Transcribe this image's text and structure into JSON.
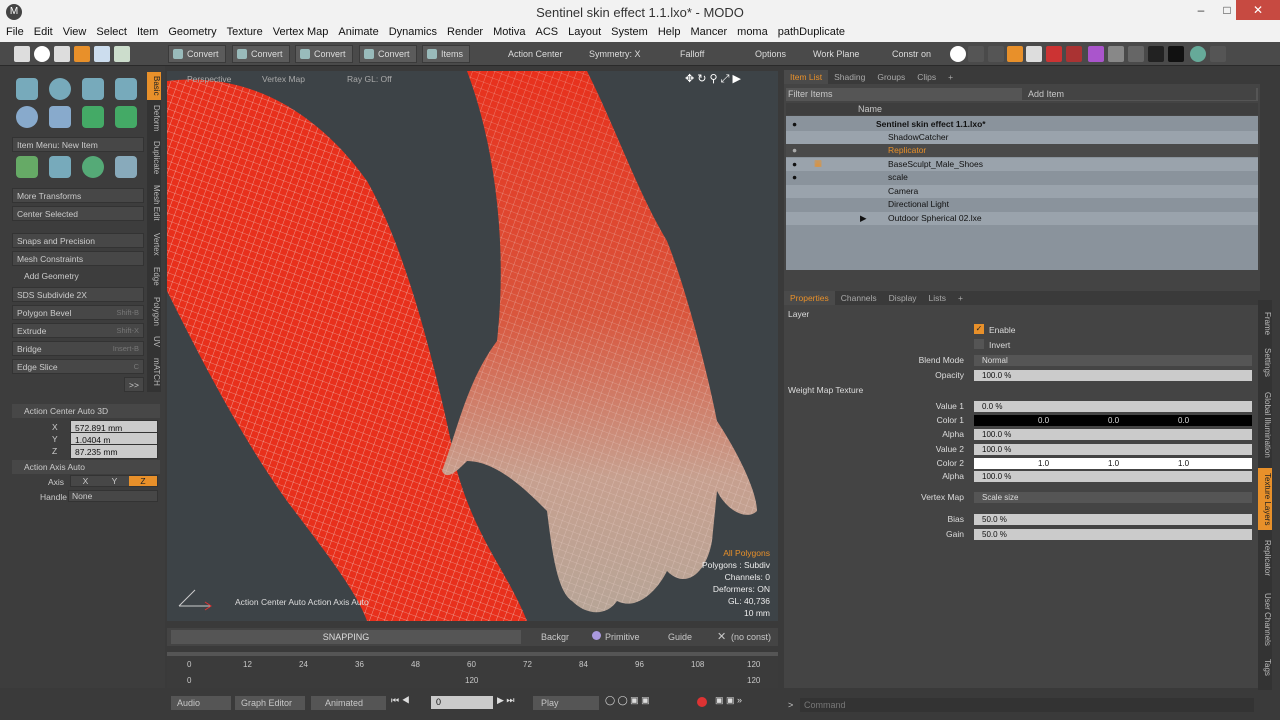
{
  "window": {
    "title": "Sentinel skin effect 1.1.lxo* - MODO",
    "app_icon": "modo-logo"
  },
  "menu": [
    "File",
    "Edit",
    "View",
    "Select",
    "Item",
    "Geometry",
    "Texture",
    "Vertex Map",
    "Animate",
    "Dynamics",
    "Render",
    "Motiva",
    "ACS",
    "Layout",
    "System",
    "Help",
    "Mancer",
    "moma",
    "pathDuplicate"
  ],
  "toolbar": {
    "convert1": "Convert",
    "convert2": "Convert",
    "convert3": "Convert",
    "convert4": "Convert",
    "items": "Items",
    "action_center": "Action Center",
    "symmetry": "Symmetry: X",
    "falloff": "Falloff",
    "options": "Options",
    "work_plane": "Work Plane",
    "constrain": "Constr on"
  },
  "left": {
    "vtabs": [
      "Basic",
      "Deform",
      "Duplicate",
      "Mesh Edit",
      "Vertex",
      "Edge",
      "Polygon",
      "UV",
      "mATCH"
    ],
    "item_menu": "Item Menu: New Item",
    "more_transforms": "More Transforms",
    "center_selected": "Center Selected",
    "snaps": "Snaps and Precision",
    "mesh_constraints": "Mesh Constraints",
    "add_geometry": "Add Geometry",
    "tools": [
      {
        "label": "SDS Subdivide 2X",
        "key": ""
      },
      {
        "label": "Polygon Bevel",
        "key": "Shift-B"
      },
      {
        "label": "Extrude",
        "key": "Shift-X"
      },
      {
        "label": "Bridge",
        "key": "Insert-B"
      },
      {
        "label": "Edge Slice",
        "key": "C"
      }
    ],
    "more": ">>",
    "action_center": "Action Center Auto 3D",
    "x": "572.891 mm",
    "y": "1.0404 m",
    "z": "87.235 mm",
    "x_label": "X",
    "y_label": "Y",
    "z_label": "Z",
    "action_axis": "Action Axis Auto",
    "axis_label": "Axis",
    "handle_label": "Handle",
    "handle_value": "None"
  },
  "viewport": {
    "view": "Perspective",
    "mode": "Vertex Map",
    "raygl": "Ray GL: Off",
    "info": {
      "polys": "All Polygons",
      "subdiv": "Polygons : Subdiv",
      "channels": "Channels: 0",
      "deformers": "Deformers: ON",
      "gl": "GL: 40,736",
      "scale": "10 mm"
    },
    "bottom_left": "Action Center Auto    Action Axis Auto"
  },
  "status": {
    "snapping": "SNAPPING",
    "backgr": "Backgr",
    "primitive": "Primitive",
    "guide": "Guide",
    "noconst": "(no const)"
  },
  "timeline": {
    "ticks": [
      "0",
      "12",
      "24",
      "36",
      "48",
      "60",
      "72",
      "84",
      "96",
      "108",
      "120"
    ],
    "start": "0",
    "end": "120",
    "current": "120"
  },
  "bottom": {
    "audio": "Audio",
    "graph": "Graph Editor",
    "animated": "Animated",
    "frame": "0",
    "play": "Play"
  },
  "itemlist": {
    "tabs": [
      "Item List",
      "Shading",
      "Groups",
      "Clips"
    ],
    "filter": "Filter Items",
    "add_item": "Add Item",
    "col_name": "Name",
    "items": [
      {
        "name": "Sentinel skin effect 1.1.lxo*",
        "level": 0
      },
      {
        "name": "ShadowCatcher",
        "level": 1
      },
      {
        "name": "Replicator",
        "level": 1
      },
      {
        "name": "BaseSculpt_Male_Shoes",
        "level": 1
      },
      {
        "name": "scale",
        "level": 1
      },
      {
        "name": "Camera",
        "level": 1
      },
      {
        "name": "Directional Light",
        "level": 1
      },
      {
        "name": "Outdoor Spherical 02.lxe",
        "level": 1
      }
    ]
  },
  "props": {
    "tabs": [
      "Properties",
      "Channels",
      "Display",
      "Lists"
    ],
    "layer": "Layer",
    "enable": "Enable",
    "invert": "Invert",
    "blend_mode_label": "Blend Mode",
    "blend_mode": "Normal",
    "opacity_label": "Opacity",
    "opacity": "100.0 %",
    "wmt": "Weight Map Texture",
    "value1_label": "Value 1",
    "value1": "0.0 %",
    "color1_label": "Color 1",
    "color1": [
      "0.0",
      "0.0",
      "0.0"
    ],
    "alpha1_label": "Alpha",
    "alpha1": "100.0 %",
    "value2_label": "Value 2",
    "value2": "100.0 %",
    "color2_label": "Color 2",
    "color2": [
      "1.0",
      "1.0",
      "1.0"
    ],
    "alpha2_label": "Alpha",
    "alpha2": "100.0 %",
    "vmap_label": "Vertex Map",
    "vmap": "Scale size",
    "bias_label": "Bias",
    "bias": "50.0 %",
    "gain_label": "Gain",
    "gain": "50.0 %",
    "vtabs": [
      "Frame",
      "Settings",
      "Global Illumination",
      "Texture Layers",
      "Replicator",
      "User Channels",
      "Tags"
    ]
  },
  "command": "Command",
  "colors": {
    "accent": "#e8902a",
    "mesh_red": "#e8301c",
    "skin": "#bba596"
  }
}
